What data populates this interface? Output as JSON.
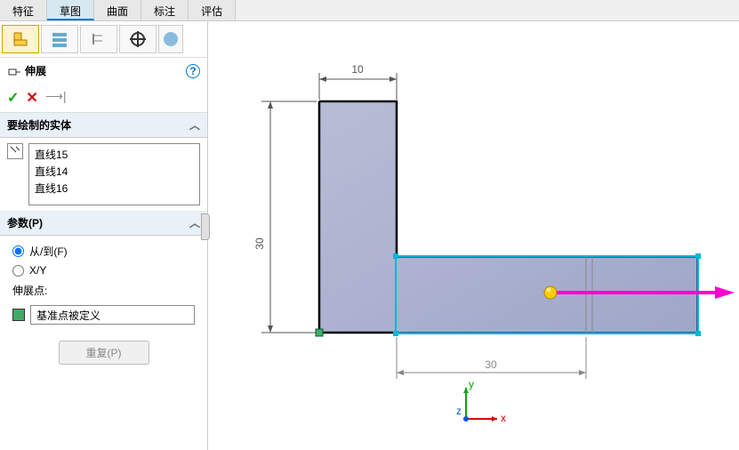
{
  "tabs": {
    "t0": "特征",
    "t1": "草图",
    "t2": "曲面",
    "t3": "标注",
    "t4": "评估"
  },
  "feature": {
    "title": "伸展"
  },
  "sections": {
    "entities": "要绘制的实体",
    "params": "参数(P)"
  },
  "entities": {
    "e0": "直线15",
    "e1": "直线14",
    "e2": "直线16"
  },
  "params": {
    "fromTo": "从/到(F)",
    "xy": "X/Y",
    "extendPoint": "伸展点:",
    "basePoint": "基准点被定义",
    "repeat": "重复(P)"
  },
  "dims": {
    "top": "10",
    "left": "30",
    "bottom": "30"
  },
  "triad": {
    "x": "x",
    "y": "y",
    "z": "z"
  }
}
